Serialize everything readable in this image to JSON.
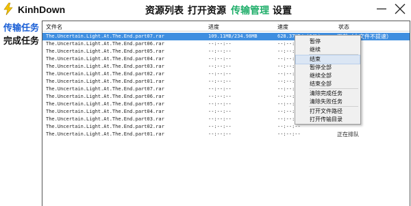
{
  "app": {
    "title": "KinhDown",
    "colors": {
      "accent": "#1fae6a",
      "side_active": "#1a5fd6",
      "selection": "#3f8ee0",
      "logo": "#f2c200"
    }
  },
  "nav": {
    "items": [
      {
        "label": "资源列表",
        "active": false
      },
      {
        "label": "打开资源",
        "active": false
      },
      {
        "label": "传输管理",
        "active": true
      },
      {
        "label": "设置",
        "active": false
      }
    ]
  },
  "window_controls": {
    "minimize": "minimize-icon",
    "close": "close-icon"
  },
  "sidebar": {
    "items": [
      {
        "label": "传输任务",
        "active": true
      },
      {
        "label": "完成任务",
        "active": false
      }
    ]
  },
  "table": {
    "headers": {
      "name": "文件名",
      "progress": "进度",
      "speed": "速度",
      "status": "状态"
    },
    "rows": [
      {
        "name": "The.Uncertain.Light.At.The.End.part07.rar",
        "progress": "109.11MB/234.98MB",
        "speed": "628.37KB/s(64%)",
        "status": "下载（大文件不提速）",
        "selected": true
      },
      {
        "name": "The.Uncertain.Light.At.The.End.part06.rar",
        "progress": "--:--:--",
        "speed": "--:--:--",
        "status": ""
      },
      {
        "name": "The.Uncertain.Light.At.The.End.part05.rar",
        "progress": "--:--:--",
        "speed": "--:--:--",
        "status": ""
      },
      {
        "name": "The.Uncertain.Light.At.The.End.part04.rar",
        "progress": "--:--:--",
        "speed": "--:--:--",
        "status": ""
      },
      {
        "name": "The.Uncertain.Light.At.The.End.part03.rar",
        "progress": "--:--:--",
        "speed": "--:--:--",
        "status": ""
      },
      {
        "name": "The.Uncertain.Light.At.The.End.part02.rar",
        "progress": "--:--:--",
        "speed": "--:--:--",
        "status": ""
      },
      {
        "name": "The.Uncertain.Light.At.The.End.part01.rar",
        "progress": "--:--:--",
        "speed": "--:--:--",
        "status": ""
      },
      {
        "name": "The.Uncertain.Light.At.The.End.part07.rar",
        "progress": "--:--:--",
        "speed": "--:--:--",
        "status": ""
      },
      {
        "name": "The.Uncertain.Light.At.The.End.part06.rar",
        "progress": "--:--:--",
        "speed": "--:--:--",
        "status": ""
      },
      {
        "name": "The.Uncertain.Light.At.The.End.part05.rar",
        "progress": "--:--:--",
        "speed": "--:--:--",
        "status": ""
      },
      {
        "name": "The.Uncertain.Light.At.The.End.part04.rar",
        "progress": "--:--:--",
        "speed": "--:--:--",
        "status": ""
      },
      {
        "name": "The.Uncertain.Light.At.The.End.part03.rar",
        "progress": "--:--:--",
        "speed": "--:--:--",
        "status": ""
      },
      {
        "name": "The.Uncertain.Light.At.The.End.part02.rar",
        "progress": "--:--:--",
        "speed": "--:--:--",
        "status": ""
      },
      {
        "name": "The.Uncertain.Light.At.The.End.part01.rar",
        "progress": "--:--:--",
        "speed": "--:--:--",
        "status": "正在排队"
      }
    ]
  },
  "context_menu": {
    "items": [
      {
        "label": "暂停"
      },
      {
        "label": "继续"
      },
      {
        "label": "结束",
        "hover": true
      },
      {
        "label": "暂停全部"
      },
      {
        "label": "继续全部"
      },
      {
        "label": "结束全部"
      },
      {
        "label": "清除完成任务"
      },
      {
        "label": "清除失败任务"
      },
      {
        "label": "打开文件路径"
      },
      {
        "label": "打开传输目录"
      }
    ]
  }
}
